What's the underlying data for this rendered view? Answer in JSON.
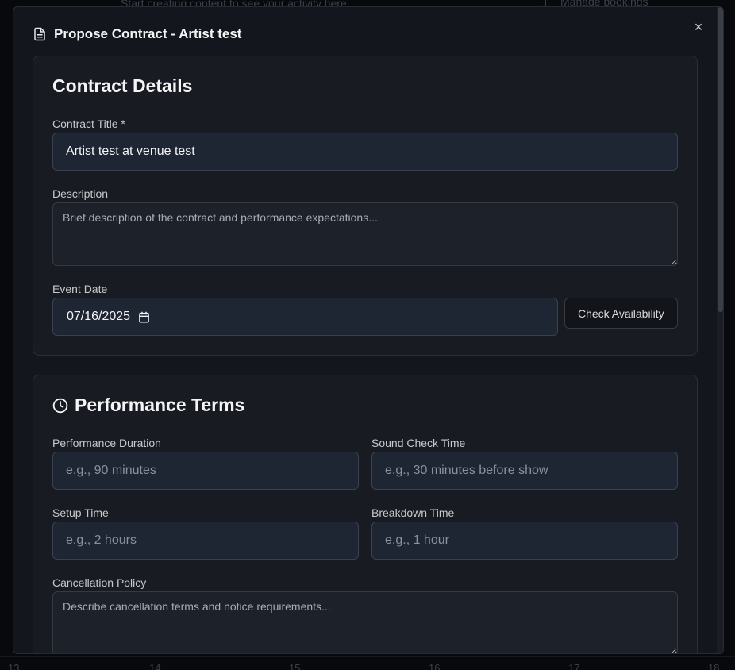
{
  "background": {
    "top_text": "Start creating content to see your activity here",
    "right_text": "Manage bookings",
    "day_numbers": [
      "13",
      "14",
      "15",
      "16",
      "17",
      "18"
    ]
  },
  "modal": {
    "title": "Propose Contract - Artist test",
    "title_icon": "document-icon",
    "close_label": "×"
  },
  "contract_details": {
    "heading": "Contract Details",
    "title_label": "Contract Title *",
    "title_value": "Artist test at venue test",
    "description_label": "Description",
    "description_placeholder": "Brief description of the contract and performance expectations...",
    "event_date_label": "Event Date",
    "event_date_value": "07/16/2025",
    "check_availability_label": "Check Availability"
  },
  "performance_terms": {
    "heading": "Performance Terms",
    "heading_icon": "clock-icon",
    "duration_label": "Performance Duration",
    "duration_placeholder": "e.g., 90 minutes",
    "sound_check_label": "Sound Check Time",
    "sound_check_placeholder": "e.g., 30 minutes before show",
    "setup_label": "Setup Time",
    "setup_placeholder": "e.g., 2 hours",
    "breakdown_label": "Breakdown Time",
    "breakdown_placeholder": "e.g., 1 hour",
    "cancellation_label": "Cancellation Policy",
    "cancellation_placeholder": "Describe cancellation terms and notice requirements..."
  },
  "colors": {
    "overlay": "#07090c",
    "modal_bg": "#13161c",
    "card_bg": "#181b22",
    "input_bg": "#1e2533"
  }
}
